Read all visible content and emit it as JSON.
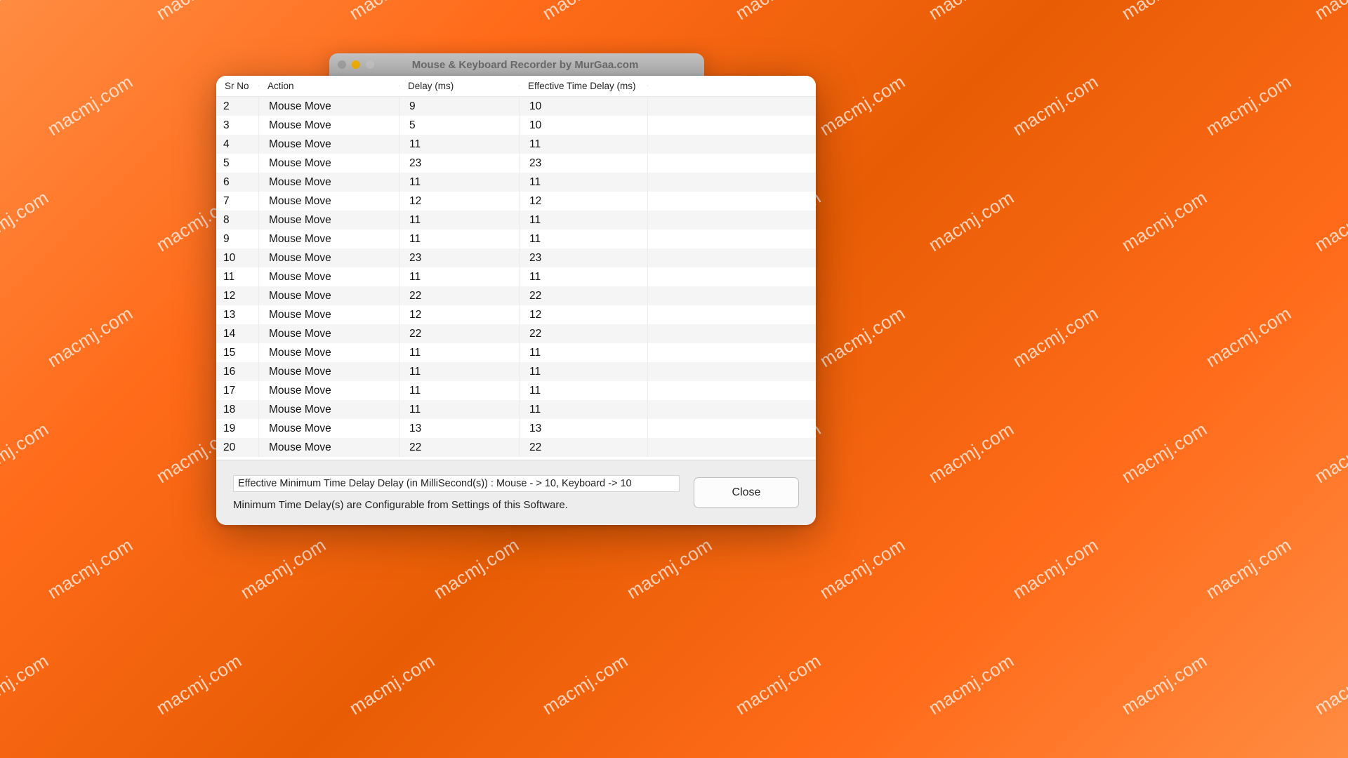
{
  "window": {
    "title": "Mouse & Keyboard Recorder by MurGaa.com"
  },
  "watermark_text": "macmj.com",
  "table": {
    "headers": {
      "sr": "Sr No",
      "action": "Action",
      "delay": "Delay (ms)",
      "effective": "Effective Time Delay (ms)"
    },
    "rows": [
      {
        "sr": "2",
        "action": "Mouse Move",
        "delay": "9",
        "effective": "10"
      },
      {
        "sr": "3",
        "action": "Mouse Move",
        "delay": "5",
        "effective": "10"
      },
      {
        "sr": "4",
        "action": "Mouse Move",
        "delay": "11",
        "effective": "11"
      },
      {
        "sr": "5",
        "action": "Mouse Move",
        "delay": "23",
        "effective": "23"
      },
      {
        "sr": "6",
        "action": "Mouse Move",
        "delay": "11",
        "effective": "11"
      },
      {
        "sr": "7",
        "action": "Mouse Move",
        "delay": "12",
        "effective": "12"
      },
      {
        "sr": "8",
        "action": "Mouse Move",
        "delay": "11",
        "effective": "11"
      },
      {
        "sr": "9",
        "action": "Mouse Move",
        "delay": "11",
        "effective": "11"
      },
      {
        "sr": "10",
        "action": "Mouse Move",
        "delay": "23",
        "effective": "23"
      },
      {
        "sr": "11",
        "action": "Mouse Move",
        "delay": "11",
        "effective": "11"
      },
      {
        "sr": "12",
        "action": "Mouse Move",
        "delay": "22",
        "effective": "22"
      },
      {
        "sr": "13",
        "action": "Mouse Move",
        "delay": "12",
        "effective": "12"
      },
      {
        "sr": "14",
        "action": "Mouse Move",
        "delay": "22",
        "effective": "22"
      },
      {
        "sr": "15",
        "action": "Mouse Move",
        "delay": "11",
        "effective": "11"
      },
      {
        "sr": "16",
        "action": "Mouse Move",
        "delay": "11",
        "effective": "11"
      },
      {
        "sr": "17",
        "action": "Mouse Move",
        "delay": "11",
        "effective": "11"
      },
      {
        "sr": "18",
        "action": "Mouse Move",
        "delay": "11",
        "effective": "11"
      },
      {
        "sr": "19",
        "action": "Mouse Move",
        "delay": "13",
        "effective": "13"
      },
      {
        "sr": "20",
        "action": "Mouse Move",
        "delay": "22",
        "effective": "22"
      }
    ]
  },
  "footer": {
    "status": "Effective Minimum Time Delay Delay (in MilliSecond(s)) : Mouse  - > 10, Keyboard -> 10",
    "hint": "Minimum Time Delay(s) are Configurable from Settings of this Software.",
    "close_label": "Close"
  }
}
